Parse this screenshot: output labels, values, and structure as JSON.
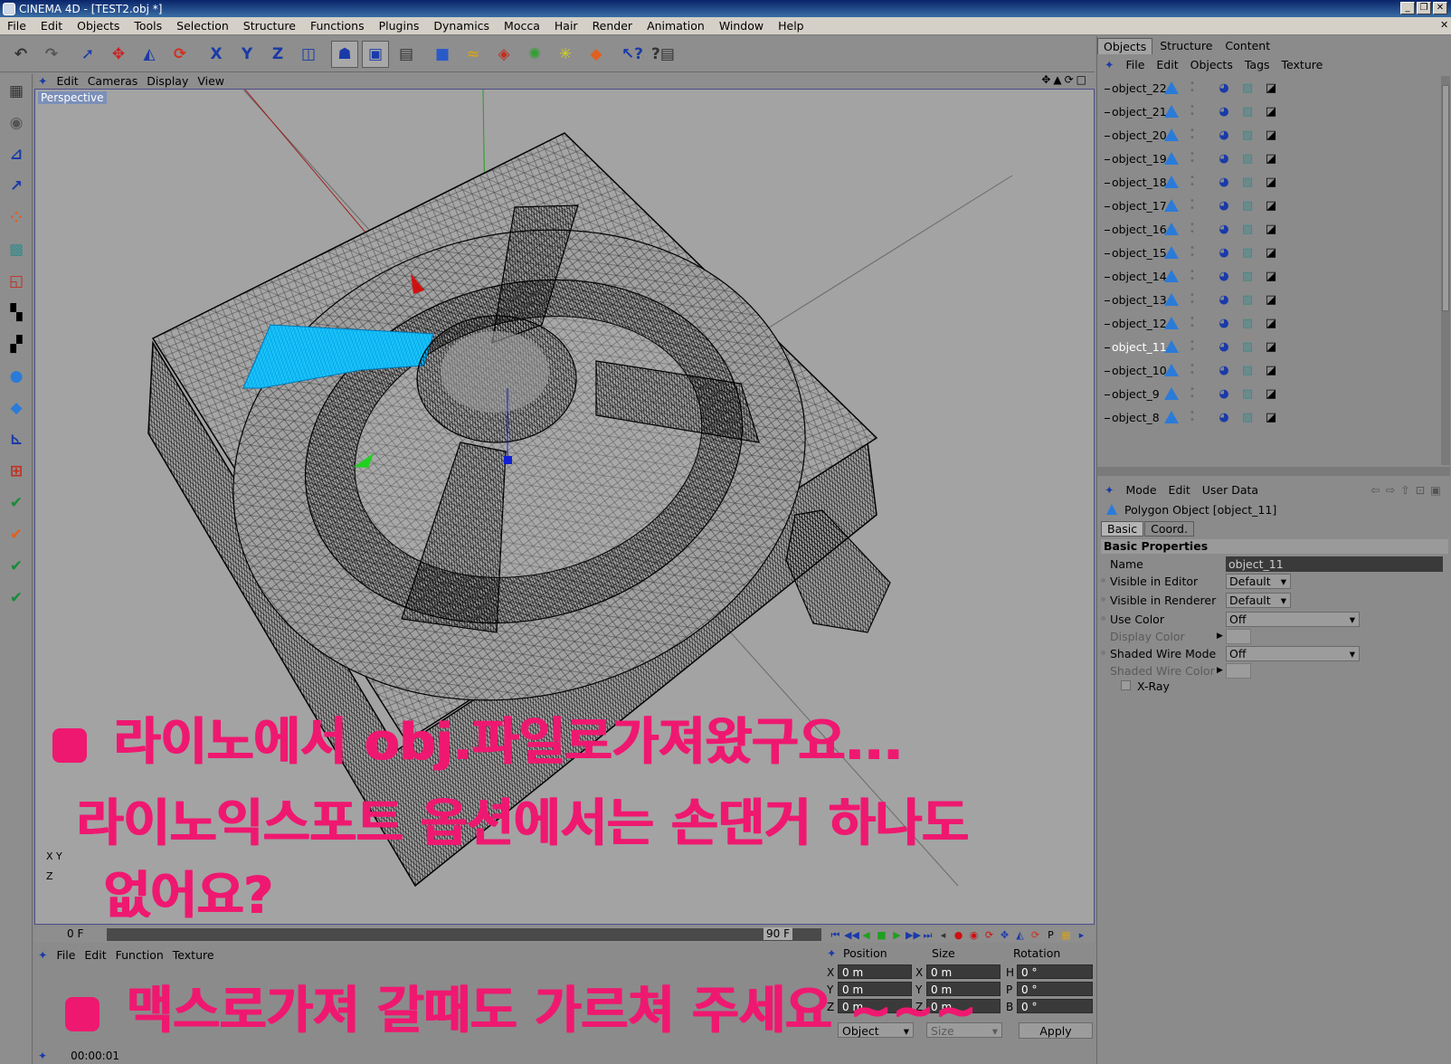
{
  "window": {
    "title": "CINEMA 4D - [TEST2.obj *]"
  },
  "menubar": {
    "items": [
      "File",
      "Edit",
      "Objects",
      "Tools",
      "Selection",
      "Structure",
      "Functions",
      "Plugins",
      "Dynamics",
      "Mocca",
      "Hair",
      "Render",
      "Animation",
      "Window",
      "Help"
    ]
  },
  "viewport": {
    "menu": [
      "Edit",
      "Cameras",
      "Display",
      "View"
    ],
    "label": "Perspective",
    "axis": {
      "x": "X",
      "y": "Y",
      "z": "Z"
    }
  },
  "timeline": {
    "start": "0 F",
    "end": "90 F"
  },
  "material": {
    "menu": [
      "File",
      "Edit",
      "Function",
      "Texture"
    ]
  },
  "coords": {
    "headers": [
      "Position",
      "Size",
      "Rotation"
    ],
    "pos_x": "0 m",
    "pos_y": "0 m",
    "pos_z": "0 m",
    "size_x": "0 m",
    "size_y": "0 m",
    "size_z": "0 m",
    "rot_h": "0 °",
    "rot_p": "0 °",
    "rot_b": "0 °",
    "labels": {
      "x": "X",
      "y": "Y",
      "z": "Z",
      "h": "H",
      "p": "P",
      "b": "B"
    },
    "mode_object": "Object",
    "mode_size": "Size",
    "apply": "Apply"
  },
  "status": {
    "time": "00:00:01"
  },
  "objects_panel": {
    "tabs": [
      "Objects",
      "Structure",
      "Content"
    ],
    "menu": [
      "File",
      "Edit",
      "Objects",
      "Tags",
      "Texture"
    ],
    "items": [
      "object_22",
      "object_21",
      "object_20",
      "object_19",
      "object_18",
      "object_17",
      "object_16",
      "object_15",
      "object_14",
      "object_13",
      "object_12",
      "object_11",
      "object_10",
      "object_9",
      "object_8"
    ]
  },
  "attributes": {
    "menu": [
      "Mode",
      "Edit",
      "User Data"
    ],
    "title": "Polygon Object [object_11]",
    "tabs": [
      "Basic",
      "Coord."
    ],
    "section": "Basic Properties",
    "name_label": "Name",
    "name_value": "object_11",
    "vis_editor_label": "Visible in Editor",
    "vis_editor_value": "Default",
    "vis_render_label": "Visible in Renderer",
    "vis_render_value": "Default",
    "use_color_label": "Use Color",
    "use_color_value": "Off",
    "display_color_label": "Display Color",
    "shaded_wire_label": "Shaded Wire Mode",
    "shaded_wire_value": "Off",
    "shaded_wire_color_label": "Shaded Wire Color",
    "xray_label": "X-Ray"
  },
  "handwriting": {
    "line1": "라이노에서 obj.파일로가져왔구요...",
    "line2": "라이노익스포트 옵션에서는 손댄거 하나도",
    "line3": "없어요?",
    "line4": "맥스로가져 갈때도 가르쳐 주세요 ~~~"
  },
  "colors": {
    "annotation": "#ef1870",
    "selection": "#19c6ff",
    "tag_blue": "#2a7bd8"
  }
}
